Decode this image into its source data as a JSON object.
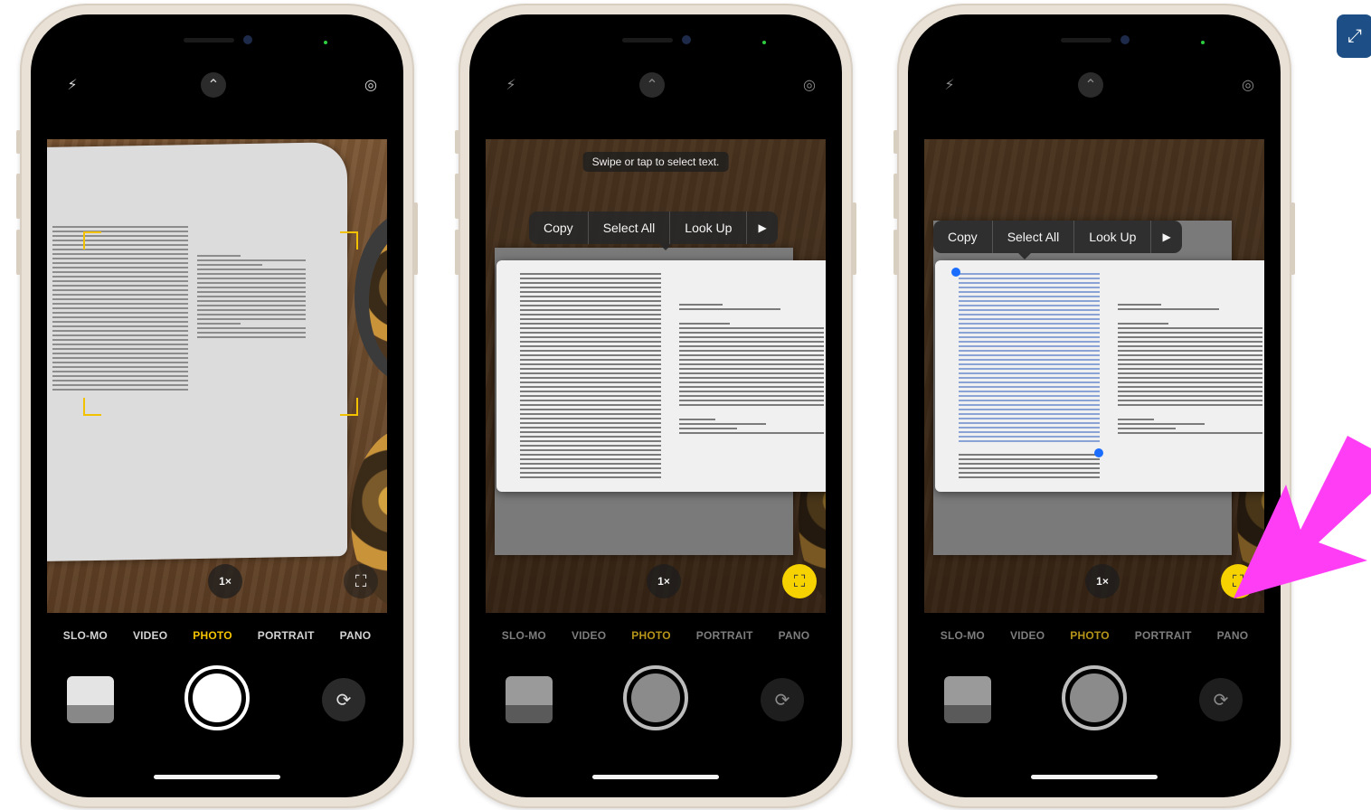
{
  "phones": [
    {
      "modes": [
        "SLO-MO",
        "VIDEO",
        "PHOTO",
        "PORTRAIT",
        "PANO"
      ],
      "active_mode": "PHOTO",
      "zoom_label": "1×"
    },
    {
      "hint": "Swipe or tap to select text.",
      "menu": {
        "copy": "Copy",
        "select_all": "Select All",
        "look_up": "Look Up",
        "more": "▶"
      },
      "modes": [
        "SLO-MO",
        "VIDEO",
        "PHOTO",
        "PORTRAIT",
        "PANO"
      ],
      "active_mode": "PHOTO",
      "zoom_label": "1×"
    },
    {
      "menu": {
        "copy": "Copy",
        "select_all": "Select All",
        "look_up": "Look Up",
        "more": "▶"
      },
      "modes": [
        "SLO-MO",
        "VIDEO",
        "PHOTO",
        "PORTRAIT",
        "PANO"
      ],
      "active_mode": "PHOTO",
      "zoom_label": "1×"
    }
  ],
  "colors": {
    "mode_active": "#f5c400",
    "text_scan_active": "#f5d200",
    "selection_handle": "#1a6dff",
    "annotation_arrow": "#ff3df5",
    "expand_button": "#1d4f86"
  },
  "icons": {
    "flash": "flash-off-icon",
    "chevron": "chevron-up-icon",
    "live": "live-photo-off-icon",
    "text_scan": "live-text-icon",
    "flip": "camera-flip-icon",
    "expand": "expand-icon"
  }
}
